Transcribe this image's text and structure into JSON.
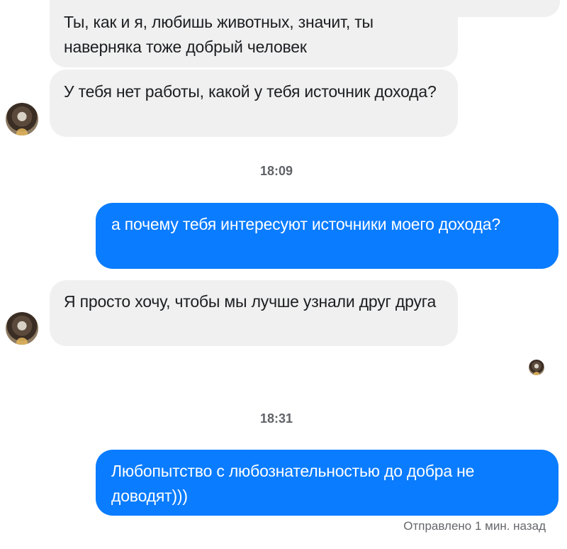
{
  "messages": [
    {
      "id": "m1",
      "text": "Ты, как и я, любишь животных, значит, ты наверняка тоже добрый человек"
    },
    {
      "id": "m2",
      "text": "У тебя нет работы, какой у тебя источник дохода?"
    },
    {
      "id": "ts1",
      "text": "18:09"
    },
    {
      "id": "m3",
      "text": "а почему тебя интересуют источники моего дохода?"
    },
    {
      "id": "m4",
      "text": "Я просто хочу, чтобы мы лучше узнали друг друга"
    },
    {
      "id": "ts2",
      "text": "18:31"
    },
    {
      "id": "m5",
      "text": "Любопытство с любознательностью до добра не доводят)))"
    }
  ],
  "status_text": "Отправлено 1 мин. назад",
  "colors": {
    "incoming": "#f0f0f0",
    "outgoing": "#0a7cff",
    "timestamp": "#5f6368"
  },
  "icons": [
    "contact-avatar",
    "seen-avatar"
  ]
}
